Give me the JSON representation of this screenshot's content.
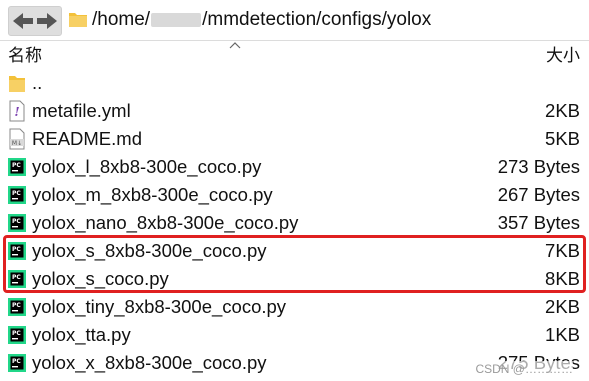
{
  "path": {
    "prefix": "/home/",
    "suffix": "/mmdetection/configs/yolox"
  },
  "columns": {
    "name": "名称",
    "size": "大小"
  },
  "files": [
    {
      "name": "..",
      "size": "",
      "icon": "folder-icon"
    },
    {
      "name": "metafile.yml",
      "size": "2KB",
      "icon": "yml-file-icon"
    },
    {
      "name": "README.md",
      "size": "5KB",
      "icon": "markdown-file-icon"
    },
    {
      "name": "yolox_l_8xb8-300e_coco.py",
      "size": "273 Bytes",
      "icon": "pycharm-file-icon"
    },
    {
      "name": "yolox_m_8xb8-300e_coco.py",
      "size": "267 Bytes",
      "icon": "pycharm-file-icon"
    },
    {
      "name": "yolox_nano_8xb8-300e_coco.py",
      "size": "357 Bytes",
      "icon": "pycharm-file-icon"
    },
    {
      "name": "yolox_s_8xb8-300e_coco.py",
      "size": "7KB",
      "icon": "pycharm-file-icon"
    },
    {
      "name": "yolox_s_coco.py",
      "size": "8KB",
      "icon": "pycharm-file-icon"
    },
    {
      "name": "yolox_tiny_8xb8-300e_coco.py",
      "size": "2KB",
      "icon": "pycharm-file-icon"
    },
    {
      "name": "yolox_tta.py",
      "size": "1KB",
      "icon": "pycharm-file-icon"
    },
    {
      "name": "yolox_x_8xb8-300e_coco.py",
      "size": "275 Bytes",
      "icon": "pycharm-file-icon"
    }
  ],
  "watermark": "CSDN @…………",
  "colors": {
    "highlight": "#e02020",
    "folder": "#f3c13a",
    "pycharm_green": "#21d789"
  }
}
